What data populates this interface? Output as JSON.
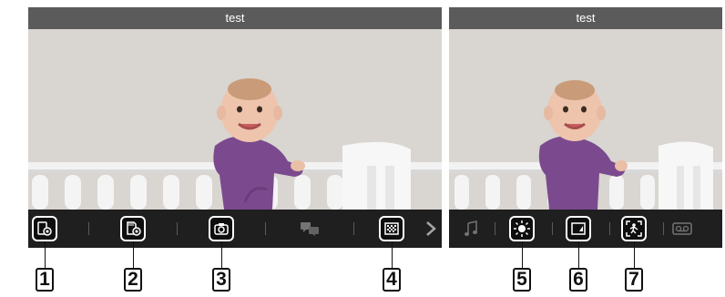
{
  "screens": [
    {
      "title": "test",
      "toolbar": {
        "buttons": [
          {
            "icon": "camera-slot-icon"
          },
          {
            "icon": "sd-card-camera-icon"
          },
          {
            "icon": "camera-snapshot-icon"
          },
          {
            "icon": "talk-icon"
          },
          {
            "icon": "zoom-grid-icon"
          },
          {
            "icon": "chevron-right-icon"
          }
        ]
      }
    },
    {
      "title": "test",
      "toolbar": {
        "buttons": [
          {
            "icon": "music-note-icon"
          },
          {
            "icon": "brightness-icon"
          },
          {
            "icon": "display-mode-icon"
          },
          {
            "icon": "pan-tilt-icon"
          },
          {
            "icon": "voicemail-icon"
          }
        ]
      }
    }
  ],
  "callouts": [
    "1",
    "2",
    "3",
    "4",
    "5",
    "6",
    "7"
  ],
  "colors": {
    "toolbar": "#1f1f1f",
    "title_bar": "#5b5b5b",
    "highlight": "#ffffff"
  }
}
